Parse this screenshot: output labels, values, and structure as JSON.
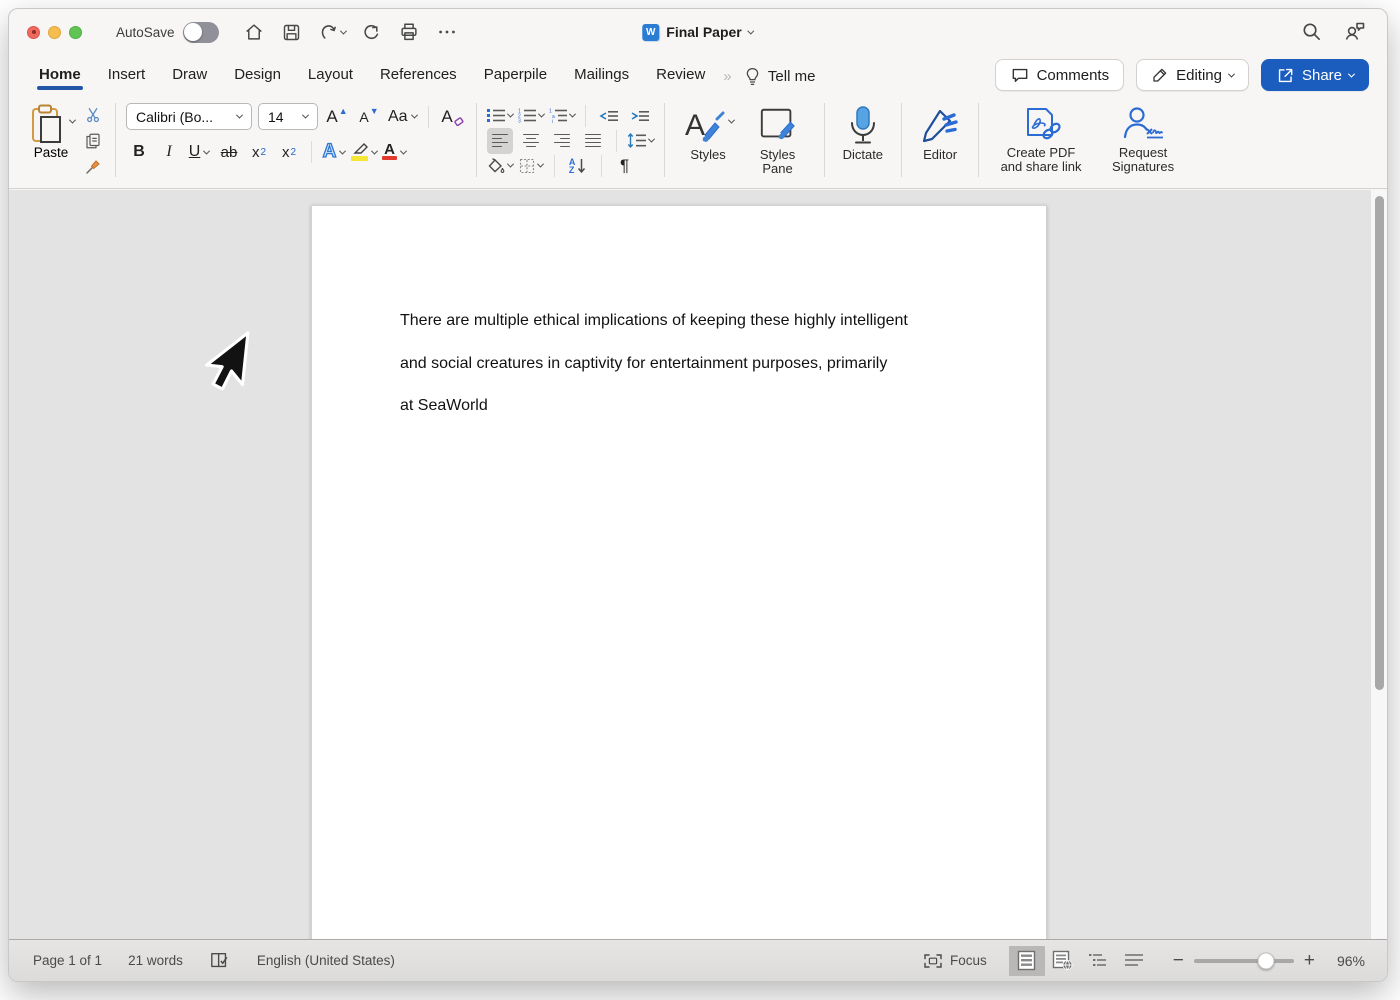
{
  "titlebar": {
    "autosave_label": "AutoSave",
    "doc_title": "Final Paper"
  },
  "tabs": [
    "Home",
    "Insert",
    "Draw",
    "Design",
    "Layout",
    "References",
    "Paperpile",
    "Mailings",
    "Review"
  ],
  "tellme_label": "Tell me",
  "actions": {
    "comments": "Comments",
    "editing": "Editing",
    "share": "Share"
  },
  "ribbon": {
    "paste_label": "Paste",
    "font_name": "Calibri (Bo...",
    "font_size": "14",
    "case_label": "Aa",
    "bold": "B",
    "italic": "I",
    "underline": "U",
    "strikethrough": "ab",
    "sub_base": "x",
    "sub_mark": "2",
    "sup_base": "x",
    "sup_mark": "2",
    "effects_label": "A",
    "font_color_label": "A",
    "sort_a": "A",
    "sort_z": "Z",
    "pilcrow": "¶",
    "styles_label": "Styles",
    "styles_pane_label": "Styles Pane",
    "dictate_label": "Dictate",
    "editor_label": "Editor",
    "create_pdf_label": "Create PDF and share link",
    "request_signatures_label": "Request Signatures"
  },
  "document": {
    "lines": [
      "There are multiple ethical implications of keeping these highly intelligent",
      "and social creatures in captivity for entertainment purposes, primarily",
      "at SeaWorld"
    ]
  },
  "statusbar": {
    "page_count": "Page 1 of 1",
    "word_count": "21 words",
    "language": "English (United States)",
    "focus_label": "Focus",
    "zoom_level": "96%"
  },
  "colors": {
    "share_button_blue": "#1a5dbe",
    "active_tab_underline": "#2456a8",
    "icon_blue": "#2b6cd4",
    "dictate_mic_blue": "#57a4e4",
    "highlight_yellow": "#f5e636",
    "font_color_red": "#e23b2e",
    "traffic_red": "#ee6a5f",
    "traffic_yellow": "#f5bd4f",
    "traffic_green": "#61c555"
  }
}
